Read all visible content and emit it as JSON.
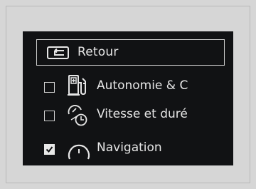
{
  "menu": {
    "back_label": "Retour",
    "items": [
      {
        "label": "Autonomie & C",
        "checked": false,
        "icon": "fuel-pump-icon"
      },
      {
        "label": "Vitesse et duré",
        "checked": false,
        "icon": "speed-time-icon"
      },
      {
        "label": "Navigation",
        "checked": true,
        "icon": "compass-gauge-icon"
      }
    ]
  }
}
